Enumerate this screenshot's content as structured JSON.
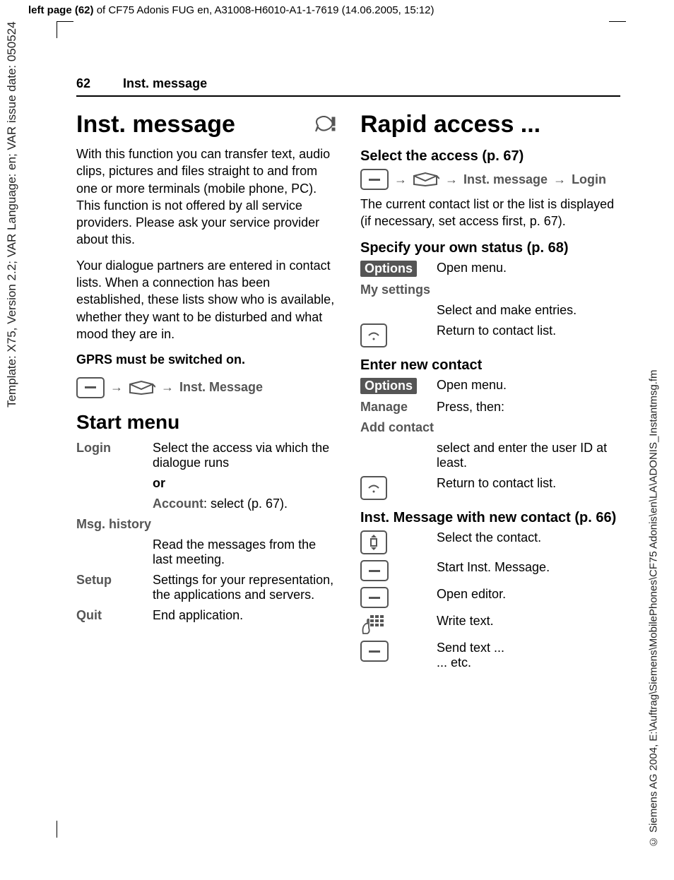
{
  "top_header": {
    "prefix_bold": "left page (62)",
    "rest": " of CF75 Adonis FUG en, A31008-H6010-A1-1-7619 (14.06.2005, 15:12)"
  },
  "side_left": "Template: X75, Version 2.2; VAR Language: en; VAR issue date: 050524",
  "side_right": "© Siemens AG 2004, E:\\Auftrag\\Siemens\\MobilePhones\\CF75 Adonis\\en\\LA\\ADONIS_Instantmsg.fm",
  "running": {
    "page_number": "62",
    "title": "Inst. message"
  },
  "left": {
    "h1": "Inst. message",
    "icon_name": "instant-message-icon",
    "p1": "With this function you can transfer text, audio clips, pictures and files straight to and from one or more terminals (mobile phone, PC). This function is not offered by all service providers. Please ask your service provider about this.",
    "p2": "Your dialogue partners are entered in contact lists. When a connection has been established, these lists show who is available, whether they want to be disturbed and what mood they are in.",
    "gprs": "GPRS must be switched on.",
    "nav_label": "Inst. Message",
    "h2": "Start menu",
    "items": {
      "login_term": "Login",
      "login_desc1": "Select the access via which the dialogue runs",
      "or": "or",
      "account_bold": "Account",
      "account_rest": ": select (p. 67).",
      "msg_term": "Msg. history",
      "msg_desc": "Read the messages from the last meeting.",
      "setup_term": "Setup",
      "setup_desc": "Settings for your representation, the applications and servers.",
      "quit_term": "Quit",
      "quit_desc": "End application."
    }
  },
  "right": {
    "h1": "Rapid access ...",
    "s1": {
      "h3": "Select the access (p. 67)",
      "nav1": "Inst. message",
      "nav2": "Login",
      "p": "The current contact list or the list is displayed (if necessary, set access first, p. 67)."
    },
    "s2": {
      "h3": "Specify your own status (p. 68)",
      "options": "Options",
      "options_desc": "Open menu.",
      "mysettings": "My settings",
      "mysettings_desc": "Select and make entries.",
      "return_desc": "Return to contact list."
    },
    "s3": {
      "h3": "Enter new contact",
      "options": "Options",
      "options_desc": "Open menu.",
      "manage": "Manage",
      "manage_desc": "Press, then:",
      "add": "Add contact",
      "add_desc": "select and enter the user ID at least.",
      "return_desc": "Return to contact list."
    },
    "s4": {
      "h3": "Inst. Message with new contact (p. 66)",
      "r1": "Select the contact.",
      "r2": "Start Inst. Message.",
      "r3": "Open editor.",
      "r4": "Write text.",
      "r5a": "Send text ...",
      "r5b": "... etc."
    }
  }
}
